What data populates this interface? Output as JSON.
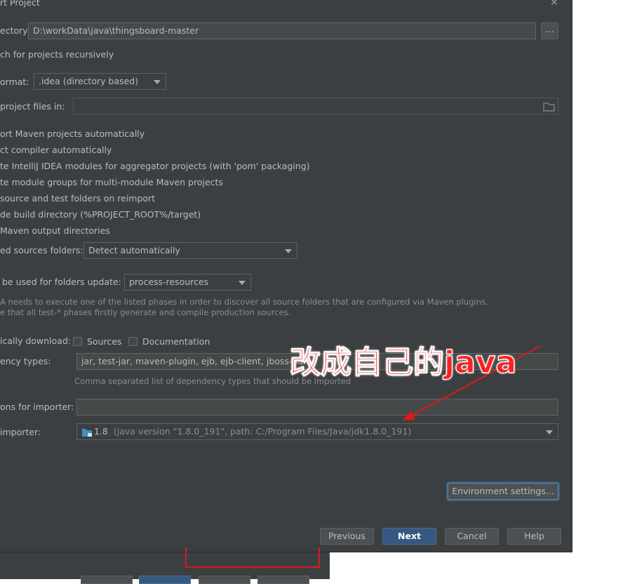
{
  "dialog": {
    "title": "rt Project",
    "close_glyph": "✕",
    "root_directory": {
      "label": "ectory",
      "value": "D:\\workData\\java\\thingsboard-master",
      "browse": "..."
    },
    "search_recursive": "ch for projects recursively",
    "project_format": {
      "label": "ormat:",
      "value": ".idea (directory based)"
    },
    "keep_project_files": {
      "label": "project files in:",
      "value": ""
    },
    "options": [
      "ort Maven projects automatically",
      "ct compiler automatically",
      "te IntelliJ IDEA modules for aggregator projects (with 'pom' packaging)",
      "te module groups for multi-module Maven projects",
      "source and test folders on reimport",
      "de build directory (%PROJECT_ROOT%/target)",
      "Maven output directories"
    ],
    "generated_sources": {
      "label": "ed sources folders:",
      "value": "Detect automatically"
    },
    "phase": {
      "label": "be used for folders update:",
      "value": "process-resources"
    },
    "phase_hint_1": "A needs to execute one of the listed phases in order to discover all source folders that are configured via Maven plugins.",
    "phase_hint_2": "e that all test-* phases firstly generate and compile production sources.",
    "auto_download": {
      "label": "ically download:",
      "sources": "Sources",
      "documentation": "Documentation"
    },
    "dependency_types": {
      "label": "ency types:",
      "value": "jar, test-jar, maven-plugin, ejb, ejb-client, jboss-har",
      "hint": "Comma separated list of dependency types that should be imported"
    },
    "vm_options": {
      "label": "ons for importer:",
      "value": ""
    },
    "jdk": {
      "label": "importer:",
      "version": "1.8",
      "detail": "(java version \"1.8.0_191\", path: C:/Program Files/Java/jdk1.8.0_191)"
    },
    "env_settings": "Environment settings...",
    "buttons": {
      "previous": "Previous",
      "next": "Next",
      "cancel": "Cancel",
      "help": "Help"
    }
  },
  "annotation": {
    "text": "改成自己的java",
    "color": "#ff2020"
  },
  "icons": {
    "folder": "folder-icon",
    "close": "close-icon",
    "jdk": "jdk-icon"
  }
}
